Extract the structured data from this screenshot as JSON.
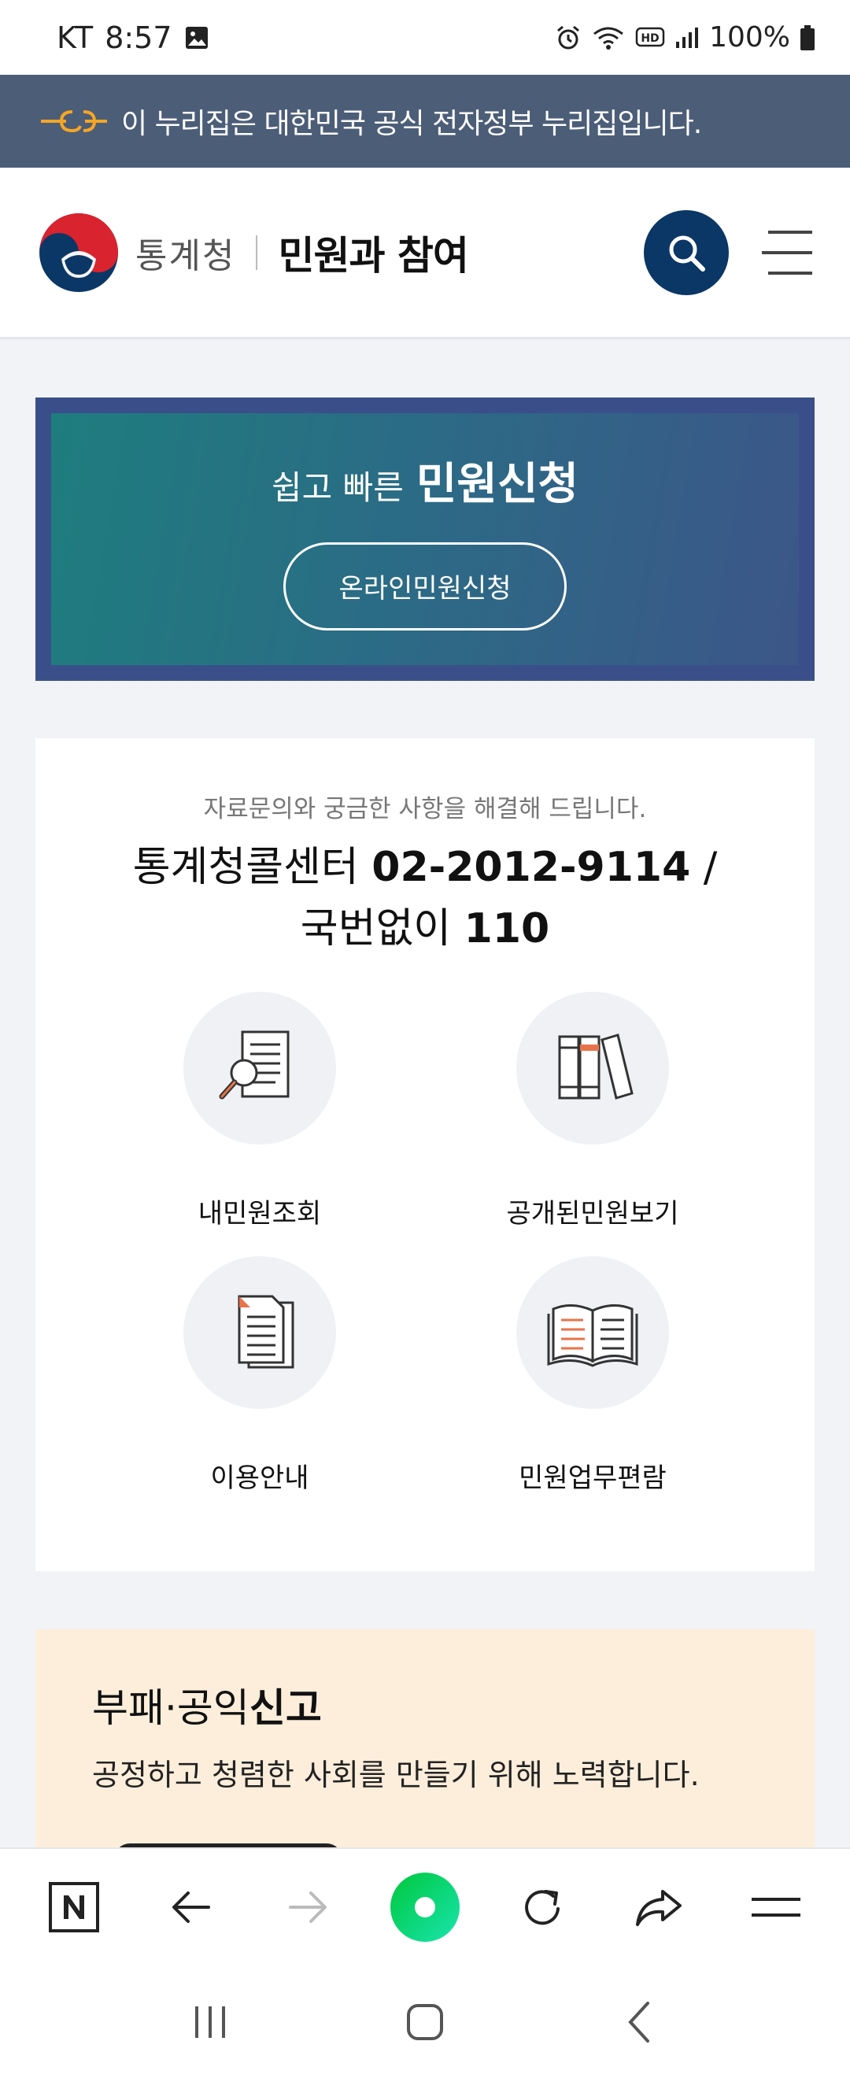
{
  "status_bar": {
    "carrier": "KT",
    "time": "8:57",
    "battery": "100%"
  },
  "gov_banner": {
    "text": "이 누리집은 대한민국 공식 전자정부 누리집입니다."
  },
  "header": {
    "org_name": "통계청",
    "section_title": "민원과 참여"
  },
  "hero": {
    "title_prefix": "쉽고 빠른",
    "title_strong": "민원신청",
    "button_label": "온라인민원신청"
  },
  "info": {
    "subtitle": "자료문의와 궁금한 사항을 해결해 드립니다.",
    "call_center_label": "통계청콜센터",
    "call_center_number": "02-2012-9114",
    "slash": " /",
    "national_label": "국번없이",
    "national_number": "110",
    "items": [
      {
        "label": "내민원조회",
        "icon": "search-document-icon"
      },
      {
        "label": "공개된민원보기",
        "icon": "books-icon"
      },
      {
        "label": "이용안내",
        "icon": "document-icon"
      },
      {
        "label": "민원업무편람",
        "icon": "open-book-icon"
      }
    ]
  },
  "report": {
    "title_prefix": "부패·공익",
    "title_strong": "신고",
    "description": "공정하고 청렴한 사회를 만들기 위해 노력합니다."
  },
  "colors": {
    "gov_banner_bg": "#4c5d78",
    "search_button_bg": "#0b3766",
    "hero_gradient_start": "#1e7d7e",
    "hero_gradient_end": "#3c5688",
    "report_bg": "#fdeedb",
    "naver_green": "#03cf5d"
  }
}
